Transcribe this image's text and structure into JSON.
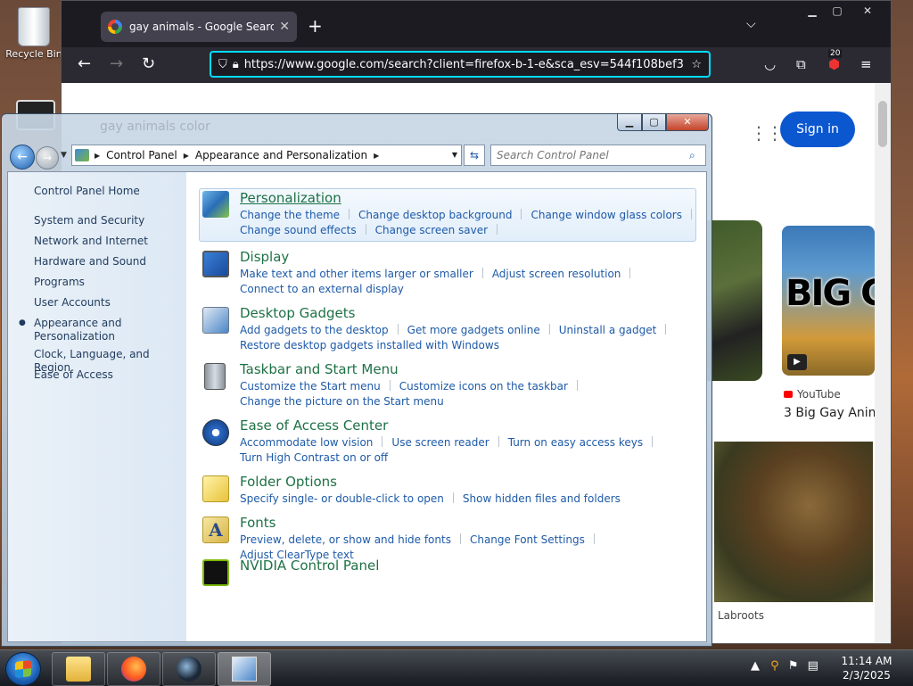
{
  "desktop": {
    "recycle_bin_label": "Recycle Bin"
  },
  "firefox": {
    "tab_title": "gay animals - Google Search",
    "url": "https://www.google.com/search?client=firefox-b-1-e&sca_esv=544f108bef3",
    "notification_badge": "20",
    "google": {
      "signin_label": "Sign in",
      "result_source": "YouTube",
      "result_title": "3 Big Gay Anim",
      "thumb_text": "BIG GA MAMMA",
      "image_caption": "Labroots",
      "search_ghost": "gay animals color"
    }
  },
  "control_panel": {
    "breadcrumb": [
      "Control Panel",
      "Appearance and Personalization"
    ],
    "search_placeholder": "Search Control Panel",
    "left_nav": {
      "home": "Control Panel Home",
      "items": [
        "System and Security",
        "Network and Internet",
        "Hardware and Sound",
        "Programs",
        "User Accounts",
        "Appearance and Personalization",
        "Clock, Language, and Region",
        "Ease of Access"
      ]
    },
    "categories": [
      {
        "title": "Personalization",
        "links": [
          "Change the theme",
          "Change desktop background",
          "Change window glass colors",
          "Change sound effects",
          "Change screen saver"
        ]
      },
      {
        "title": "Display",
        "links": [
          "Make text and other items larger or smaller",
          "Adjust screen resolution",
          "Connect to an external display"
        ]
      },
      {
        "title": "Desktop Gadgets",
        "links": [
          "Add gadgets to the desktop",
          "Get more gadgets online",
          "Uninstall a gadget",
          "Restore desktop gadgets installed with Windows"
        ]
      },
      {
        "title": "Taskbar and Start Menu",
        "links": [
          "Customize the Start menu",
          "Customize icons on the taskbar",
          "Change the picture on the Start menu"
        ]
      },
      {
        "title": "Ease of Access Center",
        "links": [
          "Accommodate low vision",
          "Use screen reader",
          "Turn on easy access keys",
          "Turn High Contrast on or off"
        ]
      },
      {
        "title": "Folder Options",
        "links": [
          "Specify single- or double-click to open",
          "Show hidden files and folders"
        ]
      },
      {
        "title": "Fonts",
        "links": [
          "Preview, delete, or show and hide fonts",
          "Change Font Settings",
          "Adjust ClearType text"
        ]
      },
      {
        "title": "NVIDIA Control Panel",
        "links": []
      }
    ]
  },
  "taskbar": {
    "time": "11:14 AM",
    "date": "2/3/2025"
  },
  "colors": {
    "link": "#1e5aa8",
    "category_title": "#1e7145",
    "firefox_accent": "#00ddff",
    "google_blue": "#0b57d0"
  }
}
